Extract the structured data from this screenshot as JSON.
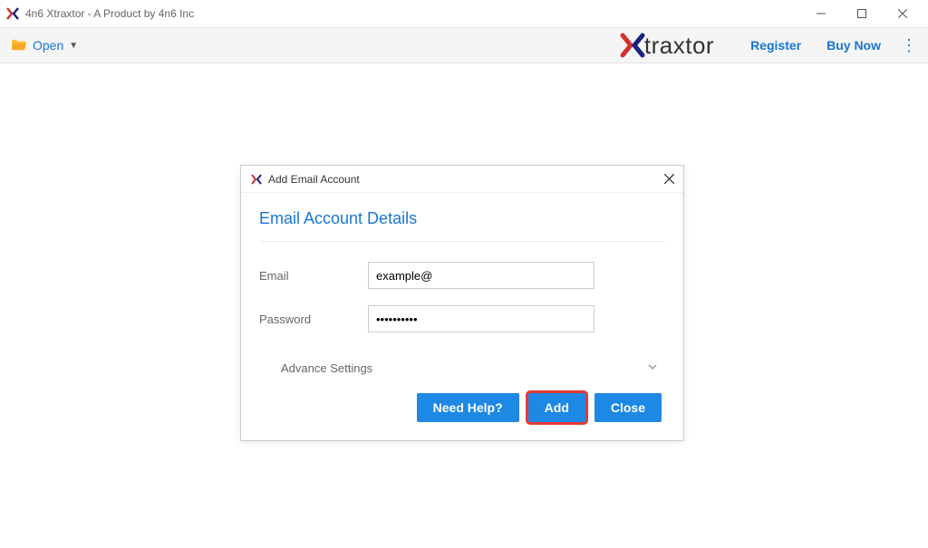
{
  "window": {
    "title": "4n6 Xtraxtor - A Product by 4n6 Inc"
  },
  "toolbar": {
    "open_label": "Open",
    "brand_text": "traxtor",
    "register_label": "Register",
    "buy_now_label": "Buy Now"
  },
  "dialog": {
    "title": "Add Email Account",
    "heading": "Email Account Details",
    "email_label": "Email",
    "email_value": "example@",
    "password_label": "Password",
    "password_value": "••••••••••",
    "advance_label": "Advance Settings",
    "need_help_label": "Need Help?",
    "add_label": "Add",
    "close_label": "Close"
  }
}
